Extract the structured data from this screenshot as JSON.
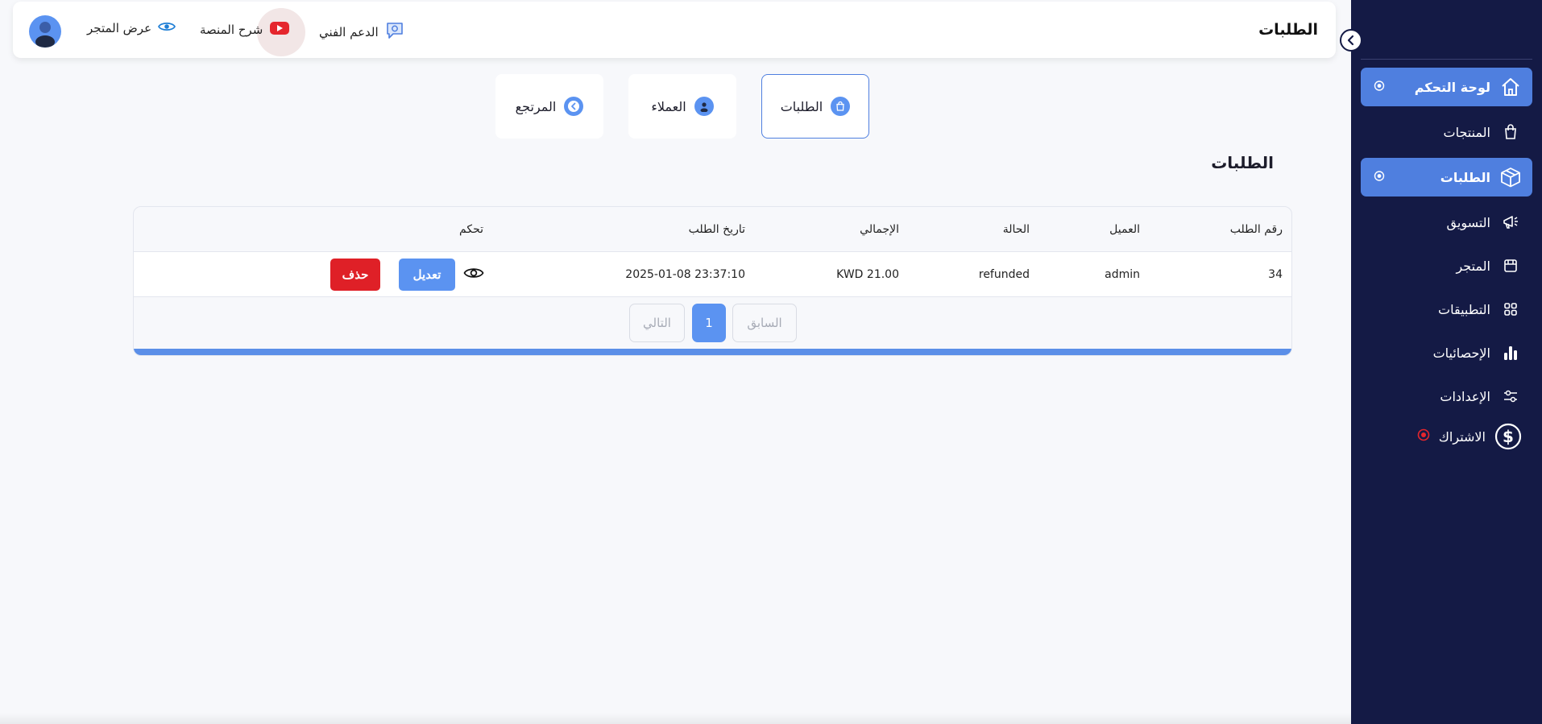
{
  "colors": {
    "sidebar_bg": "#141a45",
    "accent": "#4f7fdf",
    "primary_button": "#5b93f1",
    "danger_button": "#df2027",
    "page_bg": "#f7f8fb"
  },
  "sidebar": {
    "items": [
      {
        "label": "لوحة التحكم",
        "icon": "home-icon",
        "active": true
      },
      {
        "label": "المنتجات",
        "icon": "shopping-bag-icon",
        "active": false
      },
      {
        "label": "الطلبات",
        "icon": "box-icon",
        "active": true
      },
      {
        "label": "التسويق",
        "icon": "megaphone-icon",
        "active": false
      },
      {
        "label": "المتجر",
        "icon": "store-icon",
        "active": false
      },
      {
        "label": "التطبيقات",
        "icon": "apps-grid-icon",
        "active": false
      },
      {
        "label": "الإحصائيات",
        "icon": "bar-chart-icon",
        "active": false
      },
      {
        "label": "الإعدادات",
        "icon": "sliders-icon",
        "active": false
      },
      {
        "label": "الاشتراك",
        "icon": "dollar-circle-icon",
        "active": false
      }
    ]
  },
  "header": {
    "title": "الطلبات",
    "support_label": "الدعم الفني",
    "tutorial_label": "شرح المنصة",
    "view_store_label": "عرض المتجر"
  },
  "tabs": [
    {
      "label": "الطلبات",
      "icon": "bag-icon",
      "active": true
    },
    {
      "label": "العملاء",
      "icon": "user-icon",
      "active": false
    },
    {
      "label": "المرتجع",
      "icon": "return-icon",
      "active": false
    }
  ],
  "section": {
    "title": "الطلبات"
  },
  "table": {
    "columns": [
      "رقم الطلب",
      "العميل",
      "الحالة",
      "الإجمالي",
      "تاريخ الطلب",
      "تحكم"
    ],
    "rows": [
      {
        "order_number": "34",
        "customer": "admin",
        "status": "refunded",
        "total": "KWD 21.00",
        "date": "2025-01-08 23:37:10"
      }
    ],
    "edit_label": "تعديل",
    "delete_label": "حذف"
  },
  "pagination": {
    "prev_label": "السابق",
    "next_label": "التالي",
    "pages": [
      "1"
    ],
    "current": "1"
  }
}
